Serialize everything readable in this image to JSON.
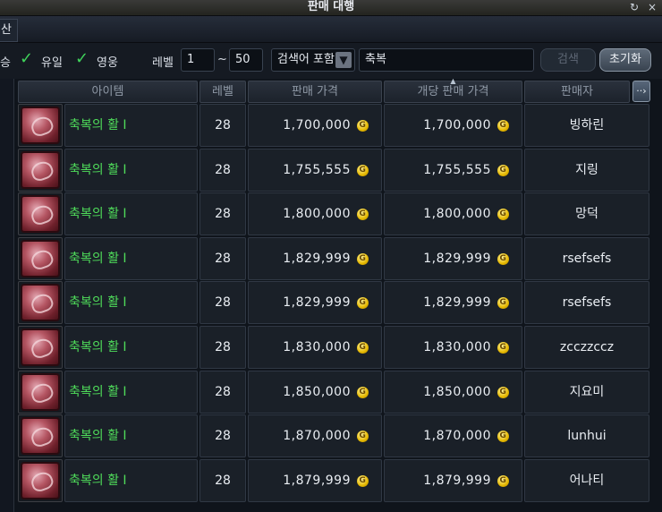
{
  "window": {
    "title": "판매 대행",
    "icons": [
      "restore-icon",
      "close-icon"
    ],
    "restore_glyph": "↻",
    "close_glyph": "×"
  },
  "tabs": {
    "left_tab_label": "산"
  },
  "filters": {
    "partial_label": "승",
    "relic_label": "유일",
    "hero_label": "영웅",
    "relic_checked": true,
    "hero_checked": true,
    "level_label": "레벨",
    "level_min": "1",
    "level_sep": "~",
    "level_max": "50",
    "search_mode": "검색어 포함",
    "search_value": "축복",
    "search_button": "검색",
    "reset_button": "초기화"
  },
  "table": {
    "headers": {
      "item": "아이템",
      "level": "레벨",
      "price": "판매 가격",
      "unit_price": "개당 판매 가격",
      "seller": "판매자",
      "more": "··›"
    },
    "sort_marker": "▲",
    "coin_glyph": "G",
    "rows": [
      {
        "name": "축복의 활 I",
        "level": "28",
        "price": "1,700,000",
        "unit_price": "1,700,000",
        "seller": "빙하린"
      },
      {
        "name": "축복의 활 I",
        "level": "28",
        "price": "1,755,555",
        "unit_price": "1,755,555",
        "seller": "지링"
      },
      {
        "name": "축복의 활 I",
        "level": "28",
        "price": "1,800,000",
        "unit_price": "1,800,000",
        "seller": "망덕"
      },
      {
        "name": "축복의 활 I",
        "level": "28",
        "price": "1,829,999",
        "unit_price": "1,829,999",
        "seller": "rsefsefs"
      },
      {
        "name": "축복의 활 I",
        "level": "28",
        "price": "1,829,999",
        "unit_price": "1,829,999",
        "seller": "rsefsefs"
      },
      {
        "name": "축복의 활 I",
        "level": "28",
        "price": "1,830,000",
        "unit_price": "1,830,000",
        "seller": "zcczzccz"
      },
      {
        "name": "축복의 활 I",
        "level": "28",
        "price": "1,850,000",
        "unit_price": "1,850,000",
        "seller": "지요미"
      },
      {
        "name": "축복의 활 I",
        "level": "28",
        "price": "1,870,000",
        "unit_price": "1,870,000",
        "seller": "lunhui"
      },
      {
        "name": "축복의 활 I",
        "level": "28",
        "price": "1,879,999",
        "unit_price": "1,879,999",
        "seller": "어나티"
      }
    ]
  },
  "colors": {
    "item_name_green": "#4fdc5a",
    "checkmark_green": "#3fd25a",
    "coin_gold": "#e6b800"
  }
}
